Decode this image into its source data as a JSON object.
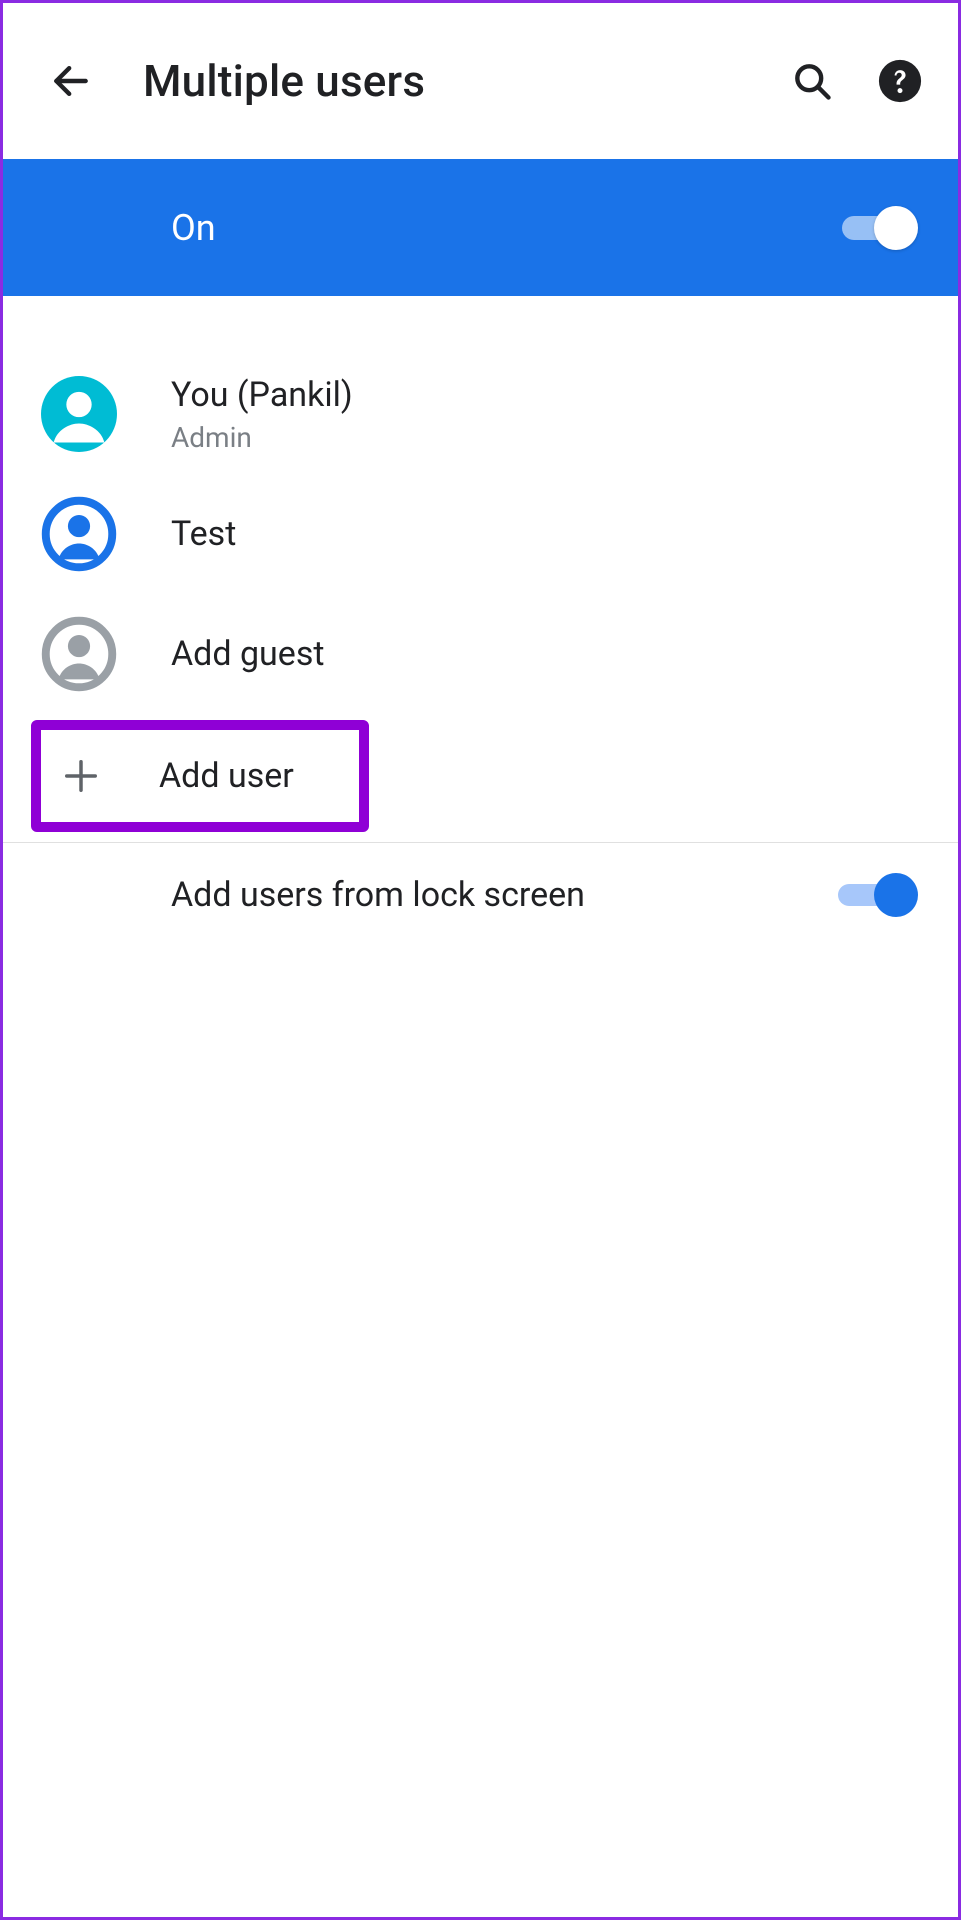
{
  "header": {
    "title": "Multiple users"
  },
  "banner": {
    "label": "On",
    "enabled": true
  },
  "users": {
    "current": {
      "name": "You (Pankil)",
      "role": "Admin"
    },
    "other": {
      "name": "Test"
    },
    "guest": {
      "label": "Add guest"
    },
    "add_user": {
      "label": "Add user"
    }
  },
  "lock_screen": {
    "label": "Add users from lock screen",
    "enabled": true
  },
  "colors": {
    "accent": "#1a73e8",
    "teal": "#00bcd4",
    "grey": "#9aa0a6",
    "highlight": "#8f00d6"
  }
}
